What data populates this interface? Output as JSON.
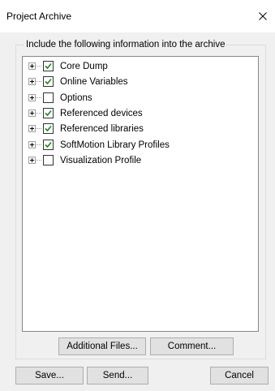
{
  "window": {
    "title": "Project Archive"
  },
  "group": {
    "legend": "Include the following information into the archive"
  },
  "tree": {
    "items": [
      {
        "label": "Core Dump",
        "checked": true
      },
      {
        "label": "Online Variables",
        "checked": true
      },
      {
        "label": "Options",
        "checked": false
      },
      {
        "label": "Referenced devices",
        "checked": true
      },
      {
        "label": "Referenced libraries",
        "checked": true
      },
      {
        "label": "SoftMotion Library Profiles",
        "checked": true
      },
      {
        "label": "Visualization Profile",
        "checked": false
      }
    ]
  },
  "buttons": {
    "additional_files": "Additional Files...",
    "comment": "Comment...",
    "save": "Save...",
    "send": "Send...",
    "cancel": "Cancel"
  },
  "colors": {
    "check_green": "#1a8c1a",
    "window_bg": "#f0f0f0"
  }
}
